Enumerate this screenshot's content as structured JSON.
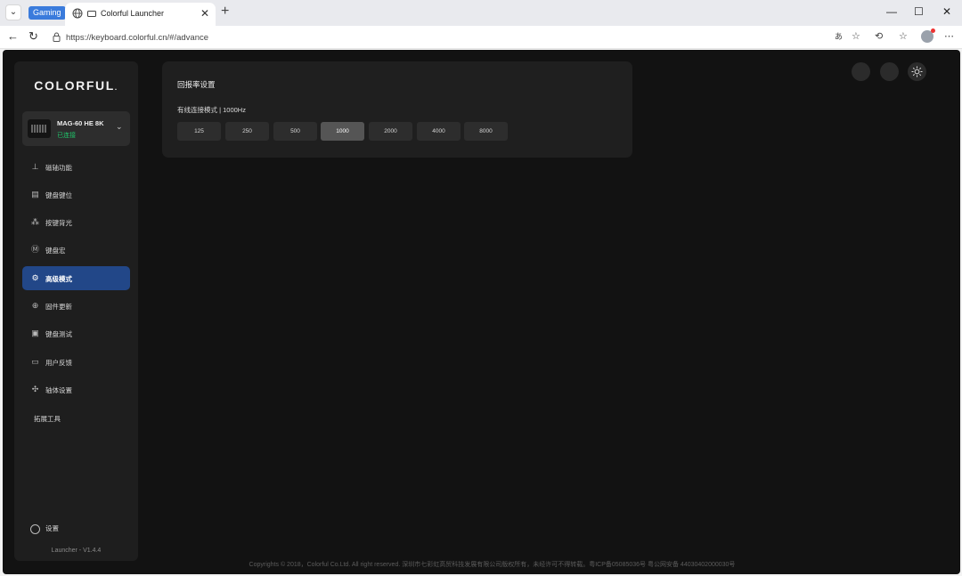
{
  "browser": {
    "badge": "Gaming",
    "tab_title": "Colorful Launcher",
    "url": "https://keyboard.colorful.cn/#/advance",
    "icons": [
      "tab-list-icon",
      "globe-icon",
      "close-icon",
      "plus-icon",
      "minimize-icon",
      "maximize-icon",
      "window-close-icon",
      "back-icon",
      "reload-icon",
      "lock-icon",
      "translate-icon",
      "star-icon",
      "extensions-icon",
      "favorites-icon",
      "profile-icon",
      "more-icon"
    ]
  },
  "sidebar": {
    "logo": "COLORFUL",
    "logo_dot": ".",
    "device": {
      "name": "MAG-60 HE 8K",
      "status": "已连接"
    },
    "items": [
      {
        "label": "磁轴功能",
        "icon": "magnet-icon"
      },
      {
        "label": "键盘键位",
        "icon": "keyboard-icon"
      },
      {
        "label": "按键背光",
        "icon": "backlight-icon"
      },
      {
        "label": "键盘宏",
        "icon": "macro-icon"
      },
      {
        "label": "高级模式",
        "icon": "advanced-icon"
      },
      {
        "label": "固件更新",
        "icon": "update-icon"
      },
      {
        "label": "键盘测试",
        "icon": "test-icon"
      },
      {
        "label": "用户反馈",
        "icon": "feedback-icon"
      },
      {
        "label": "轴体设置",
        "icon": "switch-icon"
      }
    ],
    "extension": "拓展工具",
    "settings": "设置",
    "version": "Launcher - V1.4.4"
  },
  "report_rate": {
    "title": "回报率设置",
    "mode": "有线连接模式 | 1000Hz",
    "options": [
      "125",
      "250",
      "500",
      "1000",
      "2000",
      "4000",
      "8000"
    ],
    "selected": "1000"
  },
  "footer": "Copyrights © 2018，Colorful Co.Ltd. All right reserved. 深圳市七彩虹高贸科技发展有限公司版权所有，未经许可不得转载。粤ICP备05085036号 粤公网安备 44030402000030号"
}
